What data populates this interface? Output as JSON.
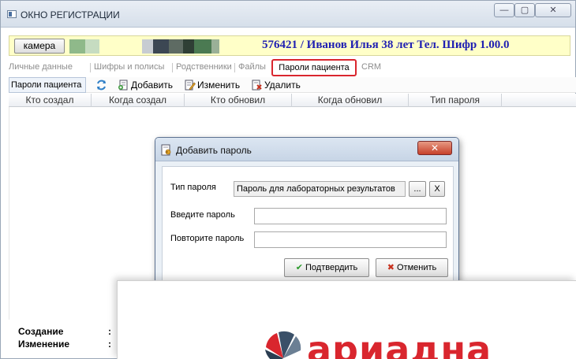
{
  "window": {
    "title": "ОКНО РЕГИСТРАЦИИ",
    "min_glyph": "—",
    "max_glyph": "▢",
    "close_glyph": "✕"
  },
  "patient": {
    "camera_label": "камера",
    "info": "576421 / Иванов Илья 38 лет Тел. Шифр 1.00.0"
  },
  "tabs": [
    "Личные данные",
    "Шифры и полисы",
    "Родственники",
    "Файлы",
    "Пароли пациента",
    "CRM"
  ],
  "toolbar": {
    "title": "Пароли пациента",
    "add": "Добавить",
    "edit": "Изменить",
    "delete": "Удалить"
  },
  "grid": {
    "columns": [
      "Кто создал",
      "Когда создал",
      "Кто обновил",
      "Когда обновил",
      "Тип пароля"
    ]
  },
  "footer": {
    "created": "Создание",
    "changed": "Изменение",
    "colon": ":"
  },
  "dialog": {
    "title": "Добавить пароль",
    "close_glyph": "✕",
    "type_label": "Тип пароля",
    "type_value": "Пароль для лабораторных результатов",
    "browse_label": "...",
    "clear_label": "X",
    "password_label": "Введите пароль",
    "repeat_label": "Повторите пароль",
    "confirm_label": "Подтвердить",
    "cancel_label": "Отменить",
    "confirm_glyph": "✔",
    "cancel_glyph": "✖"
  },
  "splash": {
    "brand": "ариадна"
  },
  "colors": {
    "accent_red": "#d9262e",
    "patient_bg": "#ffffc8",
    "patient_text": "#1f1fb2"
  }
}
